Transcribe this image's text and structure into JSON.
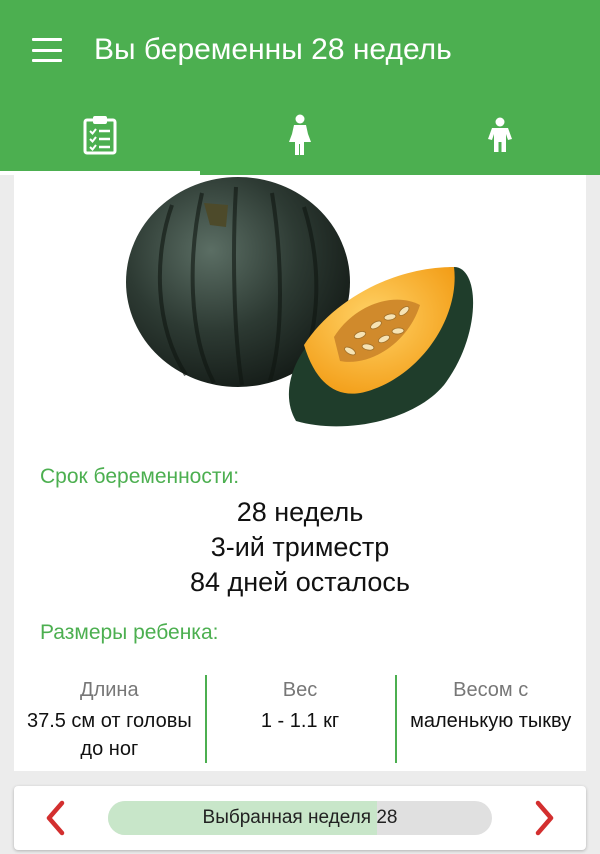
{
  "header": {
    "title": "Вы беременны 28 недель",
    "background": "#4caf50"
  },
  "tabs": [
    {
      "icon": "clipboard-checklist-icon",
      "active": true
    },
    {
      "icon": "pregnant-woman-icon",
      "active": false
    },
    {
      "icon": "child-icon",
      "active": false
    }
  ],
  "fruit_image": "acorn-squash",
  "pregnancy": {
    "label": "Срок беременности:",
    "weeks": "28 недель",
    "trimester": "3-ий триместр",
    "days_left": "84 дней осталось"
  },
  "baby": {
    "label": "Размеры ребенка:",
    "length_header": "Длина",
    "length_value": "37.5 см от головы до ног",
    "weight_header": "Вес",
    "weight_value": "1 - 1.1 кг",
    "compare_header": "Весом с",
    "compare_value": "маленькую тыкву"
  },
  "week_selector": {
    "label": "Выбранная неделя 28",
    "progress": 0.7,
    "prev_icon": "chevron-left-icon",
    "next_icon": "chevron-right-icon",
    "accent": "#d32f2f"
  }
}
